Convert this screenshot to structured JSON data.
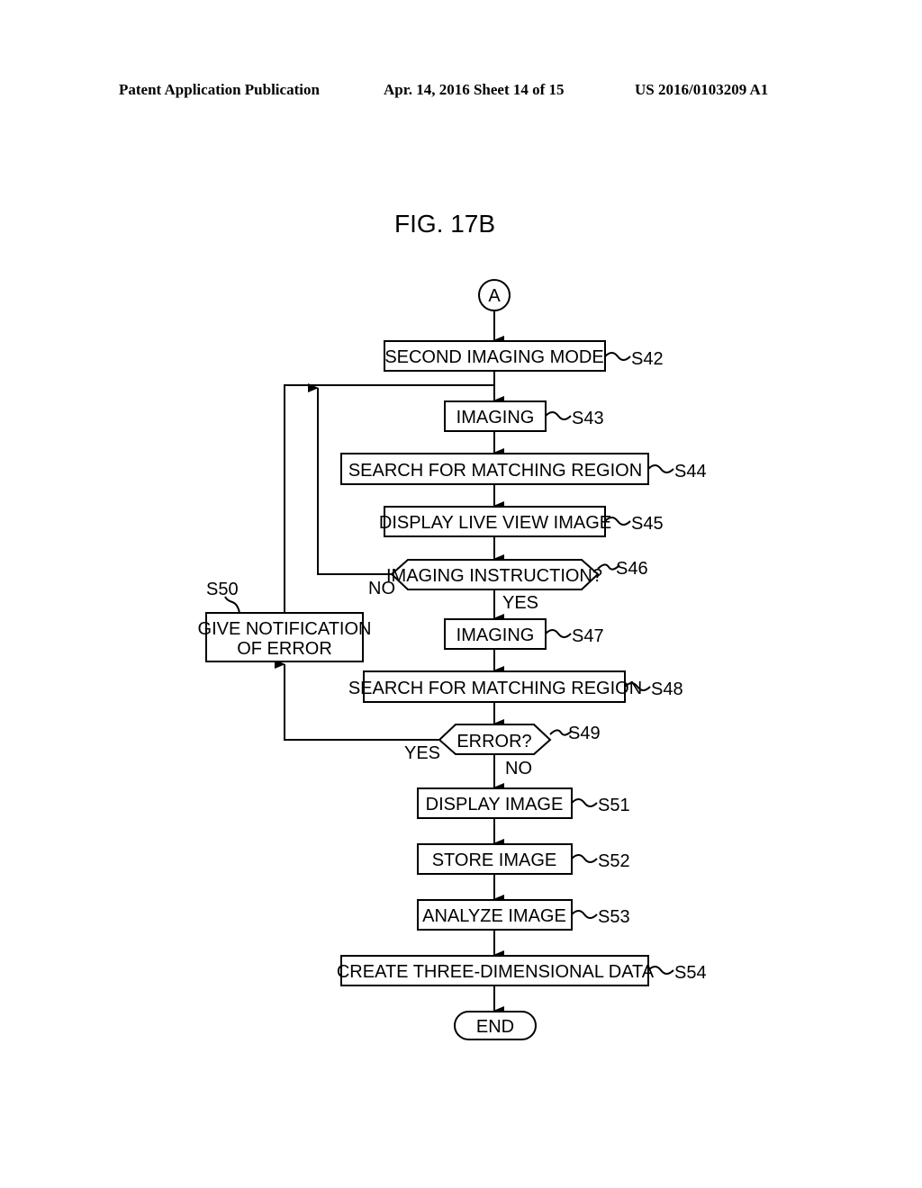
{
  "header": {
    "left": "Patent Application Publication",
    "middle": "Apr. 14, 2016  Sheet 14 of 15",
    "right": "US 2016/0103209 A1"
  },
  "figure": {
    "title": "FIG. 17B",
    "connector": "A",
    "steps": {
      "s42": {
        "label": "SECOND IMAGING MODE",
        "id": "S42"
      },
      "s43": {
        "label": "IMAGING",
        "id": "S43"
      },
      "s44": {
        "label": "SEARCH FOR MATCHING REGION",
        "id": "S44"
      },
      "s45": {
        "label": "DISPLAY LIVE VIEW IMAGE",
        "id": "S45"
      },
      "s46": {
        "label": "IMAGING INSTRUCTION?",
        "id": "S46",
        "yes": "YES",
        "no": "NO"
      },
      "s47": {
        "label": "IMAGING",
        "id": "S47"
      },
      "s48": {
        "label": "SEARCH FOR MATCHING REGION",
        "id": "S48"
      },
      "s49": {
        "label": "ERROR?",
        "id": "S49",
        "yes": "YES",
        "no": "NO"
      },
      "s50": {
        "label_line1": "GIVE NOTIFICATION",
        "label_line2": "OF ERROR",
        "id": "S50"
      },
      "s51": {
        "label": "DISPLAY IMAGE",
        "id": "S51"
      },
      "s52": {
        "label": "STORE IMAGE",
        "id": "S52"
      },
      "s53": {
        "label": "ANALYZE IMAGE",
        "id": "S53"
      },
      "s54": {
        "label": "CREATE THREE-DIMENSIONAL DATA",
        "id": "S54"
      }
    },
    "end": "END"
  }
}
